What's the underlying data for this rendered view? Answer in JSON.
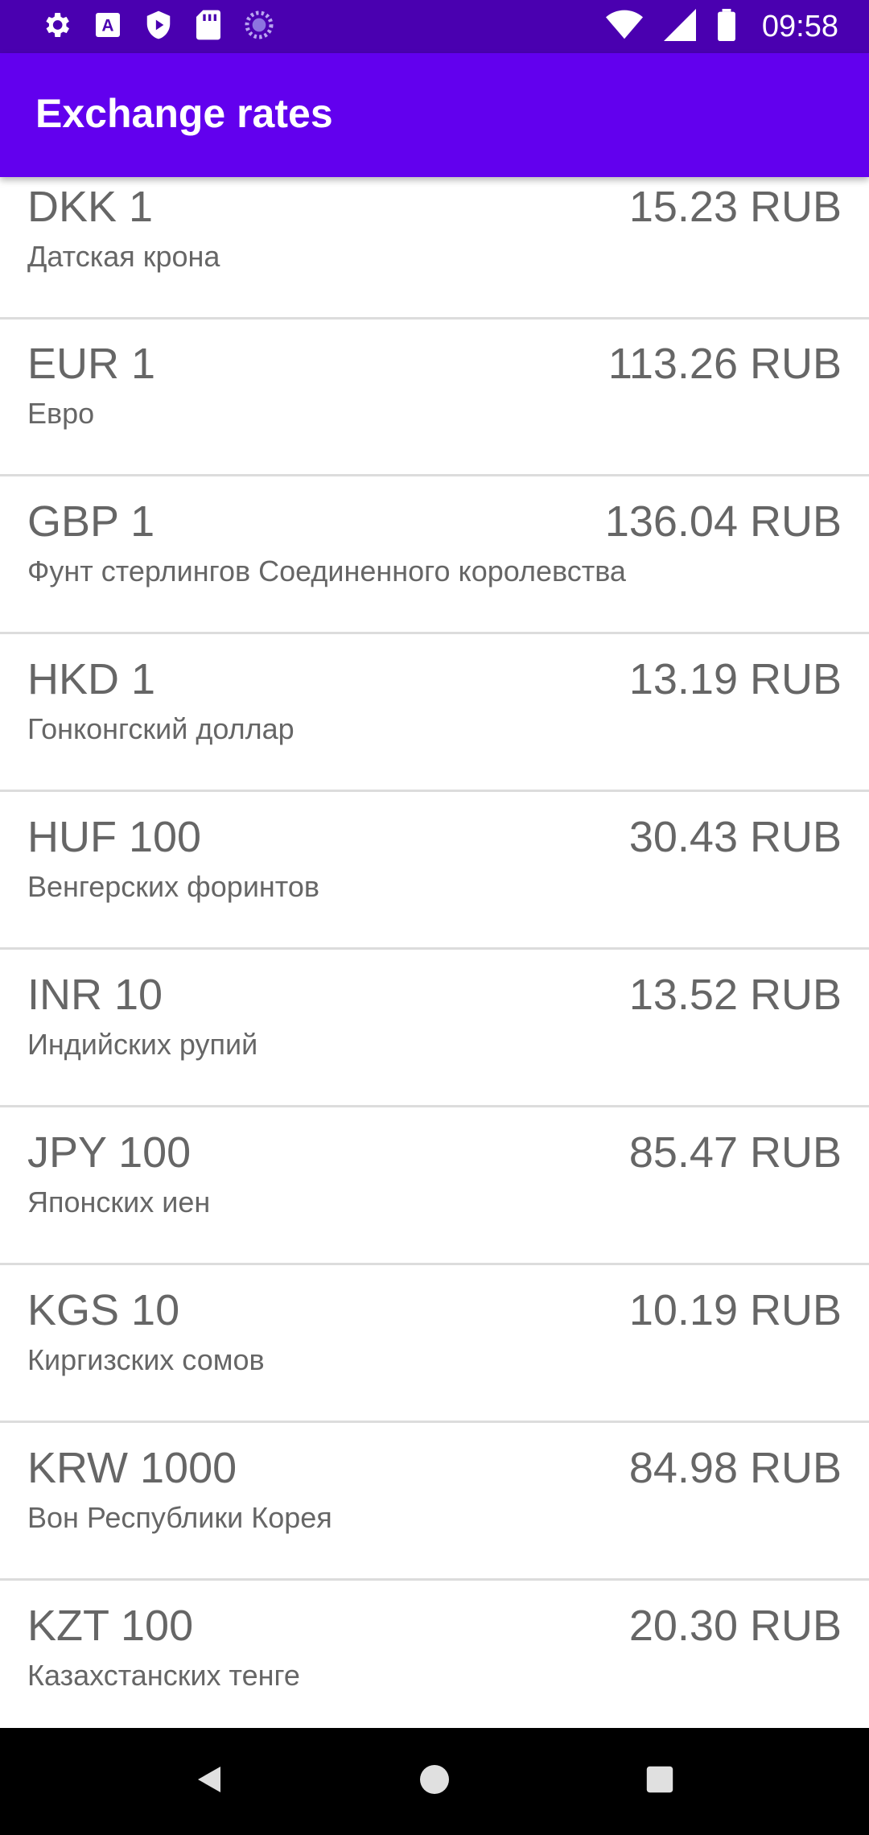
{
  "status_bar": {
    "time": "09:58",
    "icons_left": [
      "gear-icon",
      "font-a-icon",
      "shield-play-icon",
      "sd-card-icon",
      "spinner-icon"
    ],
    "icons_right": [
      "wifi-icon",
      "signal-icon",
      "battery-icon"
    ]
  },
  "app_bar": {
    "title": "Exchange rates",
    "color": "#6200ee"
  },
  "rates": [
    {
      "code": "DKK 1",
      "rate": "15.23 RUB",
      "name": "Датская крона"
    },
    {
      "code": "EUR 1",
      "rate": "113.26 RUB",
      "name": "Евро"
    },
    {
      "code": "GBP 1",
      "rate": "136.04 RUB",
      "name": "Фунт стерлингов Соединенного королевства"
    },
    {
      "code": "HKD 1",
      "rate": "13.19 RUB",
      "name": "Гонконгский доллар"
    },
    {
      "code": "HUF 100",
      "rate": "30.43 RUB",
      "name": "Венгерских форинтов"
    },
    {
      "code": "INR 10",
      "rate": "13.52 RUB",
      "name": "Индийских рупий"
    },
    {
      "code": "JPY 100",
      "rate": "85.47 RUB",
      "name": "Японских иен"
    },
    {
      "code": "KGS 10",
      "rate": "10.19 RUB",
      "name": "Киргизских сомов"
    },
    {
      "code": "KRW 1000",
      "rate": "84.98 RUB",
      "name": "Вон Республики Корея"
    },
    {
      "code": "KZT 100",
      "rate": "20.30 RUB",
      "name": "Казахстанских тенге"
    }
  ],
  "nav_bar": {
    "buttons": [
      "back-icon",
      "home-icon",
      "recents-icon"
    ]
  }
}
